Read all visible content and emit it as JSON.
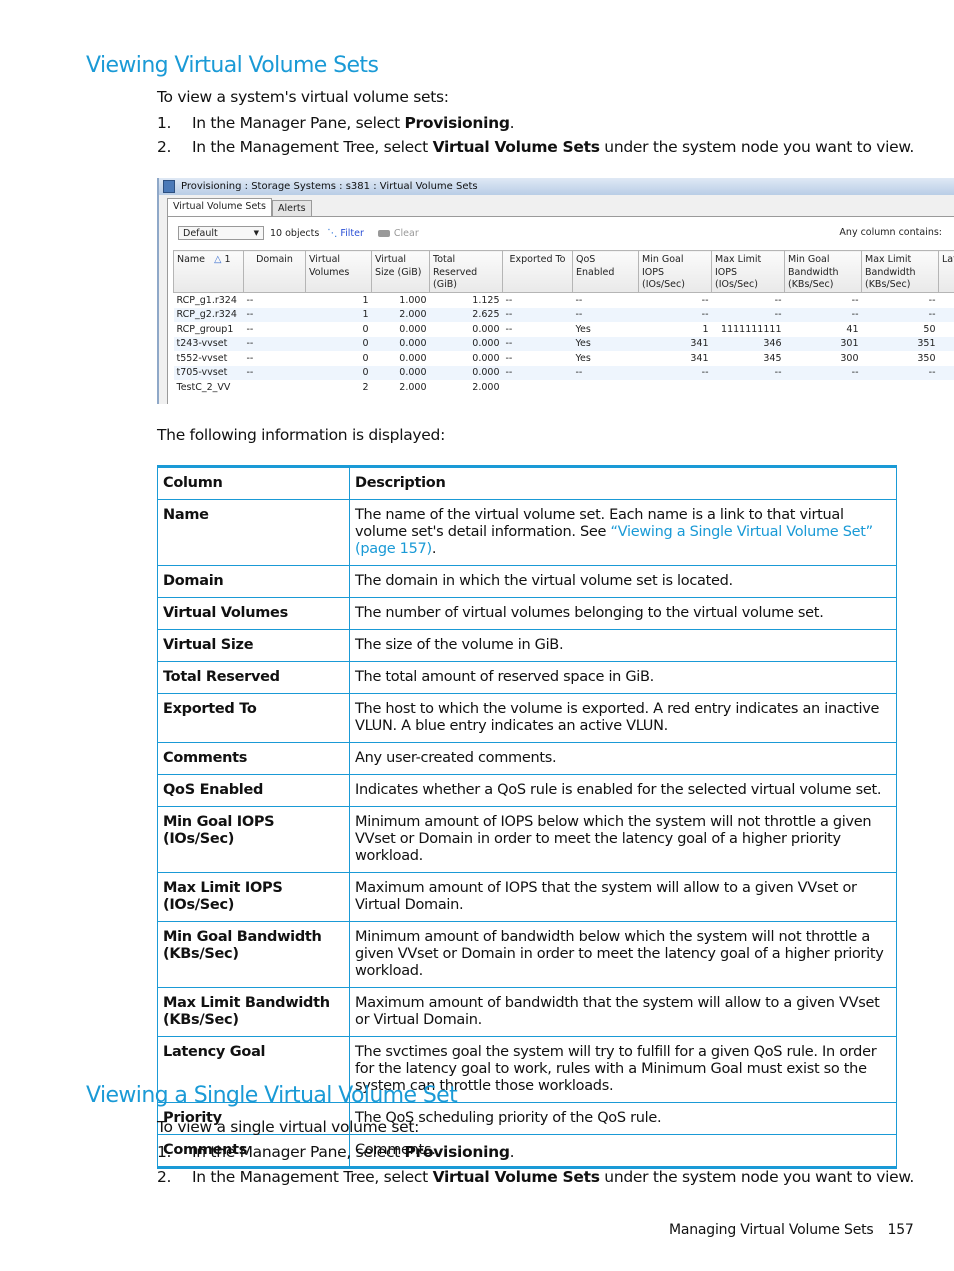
{
  "section1": {
    "title": "Viewing Virtual Volume Sets",
    "intro": "To view a system's virtual volume sets:",
    "steps": [
      {
        "num": "1.",
        "pre": "In the Manager Pane, select ",
        "bold": "Provisioning",
        "post": "."
      },
      {
        "num": "2.",
        "pre": "In the Management Tree, select ",
        "bold": "Virtual Volume Sets",
        "post": " under the system node you want to view."
      }
    ]
  },
  "app": {
    "title": "Provisioning : Storage Systems : s381 : Virtual Volume Sets",
    "tabs": [
      "Virtual Volume Sets",
      "Alerts"
    ],
    "view_select": "Default",
    "object_count": "10 objects",
    "filter_label": "Filter",
    "clear_label": "Clear",
    "any_column_label": "Any column contains:",
    "columns": [
      "Name",
      "Domain",
      "Virtual Volumes",
      "Virtual Size (GiB)",
      "Total Reserved (GiB)",
      "Exported To",
      "QoS Enabled",
      "Min Goal IOPS (IOs/Sec)",
      "Max Limit IOPS (IOs/Sec)",
      "Min Goal Bandwidth (KBs/Sec)",
      "Max Limit Bandwidth (KBs/Sec)",
      "Lat"
    ],
    "sort_indicator": "1",
    "rows": [
      [
        "RCP_g1.r324",
        "--",
        "1",
        "1.000",
        "1.125",
        "--",
        "--",
        "--",
        "--",
        "--",
        "--"
      ],
      [
        "RCP_g2.r324",
        "--",
        "1",
        "2.000",
        "2.625",
        "--",
        "--",
        "--",
        "--",
        "--",
        "--"
      ],
      [
        "RCP_group1",
        "--",
        "0",
        "0.000",
        "0.000",
        "--",
        "Yes",
        "1",
        "1111111111",
        "41",
        "50"
      ],
      [
        "t243-vvset",
        "--",
        "0",
        "0.000",
        "0.000",
        "--",
        "Yes",
        "341",
        "346",
        "301",
        "351"
      ],
      [
        "t552-vvset",
        "--",
        "0",
        "0.000",
        "0.000",
        "--",
        "Yes",
        "341",
        "345",
        "300",
        "350"
      ],
      [
        "t705-vvset",
        "--",
        "0",
        "0.000",
        "0.000",
        "--",
        "--",
        "--",
        "--",
        "--",
        "--"
      ],
      [
        "TestC_2_VV",
        "",
        "2",
        "2.000",
        "2.000",
        "",
        "",
        "",
        "",
        "",
        ""
      ]
    ]
  },
  "following_text": "The following information is displayed:",
  "info_table": {
    "headers": [
      "Column",
      "Description"
    ],
    "rows": [
      {
        "col": "Name",
        "desc": "The name of the virtual volume set. Each name is a link to that virtual volume set's detail information. See ",
        "link": "“Viewing a Single Virtual Volume Set” (page 157)",
        "after": "."
      },
      {
        "col": "Domain",
        "desc": "The domain in which the virtual volume set is located."
      },
      {
        "col": "Virtual Volumes",
        "desc": "The number of virtual volumes belonging to the virtual volume set."
      },
      {
        "col": "Virtual Size",
        "desc": "The size of the volume in GiB."
      },
      {
        "col": "Total Reserved",
        "desc": "The total amount of reserved space in GiB."
      },
      {
        "col": "Exported To",
        "desc": "The host to which the volume is exported. A red entry indicates an inactive VLUN. A blue entry indicates an active VLUN."
      },
      {
        "col": "Comments",
        "desc": "Any user-created comments."
      },
      {
        "col": "QoS Enabled",
        "desc": "Indicates whether a QoS rule is enabled for the selected virtual volume set."
      },
      {
        "col": "Min Goal IOPS (IOs/Sec)",
        "desc": "Minimum amount of IOPS below which the system will not throttle a given VVset or Domain in order to meet the latency goal of a higher priority workload."
      },
      {
        "col": "Max Limit IOPS (IOs/Sec)",
        "desc": "Maximum amount of IOPS that the system will allow to a given VVset or Virtual Domain."
      },
      {
        "col": "Min Goal Bandwidth (KBs/Sec)",
        "desc": "Minimum amount of bandwidth below which the system will not throttle a given VVset or Domain in order to meet the latency goal of a higher priority workload."
      },
      {
        "col": "Max Limit Bandwidth (KBs/Sec)",
        "desc": "Maximum amount of bandwidth that the system will allow to a given VVset or Virtual Domain."
      },
      {
        "col": "Latency Goal",
        "desc": "The svctimes goal the system will try to fulfill for a given QoS rule. In order for the latency goal to work, rules with a Minimum Goal must exist so the system can throttle those workloads."
      },
      {
        "col": "Priority",
        "desc": "The QoS scheduling priority of the QoS rule."
      },
      {
        "col": "Comments",
        "desc": "Comments."
      }
    ]
  },
  "section2": {
    "title": "Viewing a Single Virtual Volume Set",
    "intro": "To view a single virtual volume set:",
    "steps": [
      {
        "num": "1.",
        "pre": "In the Manager Pane, select ",
        "bold": "Provisioning",
        "post": "."
      },
      {
        "num": "2.",
        "pre": "In the Management Tree, select ",
        "bold": "Virtual Volume Sets",
        "post": " under the system node you want to view."
      }
    ]
  },
  "footer": {
    "chapter": "Managing Virtual Volume Sets",
    "page": "157"
  },
  "colors": {
    "accent": "#1a9ad6",
    "link": "#1a9ad6",
    "filter_link": "#2a4fd6"
  }
}
